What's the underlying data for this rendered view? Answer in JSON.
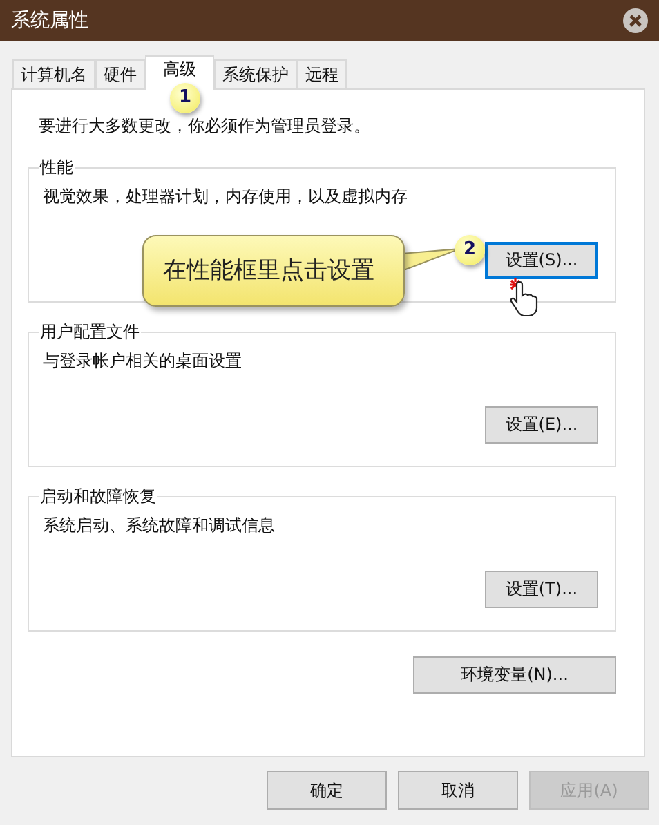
{
  "window": {
    "title": "系统属性"
  },
  "tabs": [
    {
      "label": "计算机名",
      "selected": false
    },
    {
      "label": "硬件",
      "selected": false
    },
    {
      "label": "高级",
      "selected": true
    },
    {
      "label": "系统保护",
      "selected": false
    },
    {
      "label": "远程",
      "selected": false
    }
  ],
  "notice": "要进行大多数更改，你必须作为管理员登录。",
  "groups": [
    {
      "title": "性能",
      "description": "视觉效果，处理器计划，内存使用，以及虚拟内存",
      "button": {
        "label": "设置(S)...",
        "focused": true
      }
    },
    {
      "title": "用户配置文件",
      "description": "与登录帐户相关的桌面设置",
      "button": {
        "label": "设置(E)...",
        "focused": false
      }
    },
    {
      "title": "启动和故障恢复",
      "description": "系统启动、系统故障和调试信息",
      "button": {
        "label": "设置(T)...",
        "focused": false
      }
    }
  ],
  "env_button": {
    "label": "环境变量(N)...",
    "disabled": false
  },
  "buttons": [
    {
      "label": "确定",
      "disabled": false
    },
    {
      "label": "取消",
      "disabled": false
    },
    {
      "label": "应用(A)",
      "disabled": true
    }
  ],
  "annotations": {
    "badge_1": "1",
    "badge_2": "2",
    "callout": "在性能框里点击设置"
  }
}
